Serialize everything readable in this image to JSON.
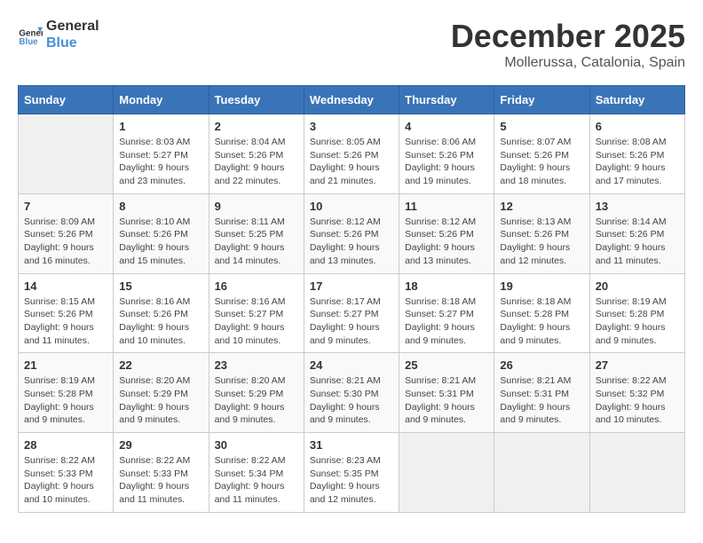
{
  "header": {
    "logo_line1": "General",
    "logo_line2": "Blue",
    "title": "December 2025",
    "subtitle": "Mollerussa, Catalonia, Spain"
  },
  "weekdays": [
    "Sunday",
    "Monday",
    "Tuesday",
    "Wednesday",
    "Thursday",
    "Friday",
    "Saturday"
  ],
  "weeks": [
    [
      {
        "day": "",
        "info": ""
      },
      {
        "day": "1",
        "info": "Sunrise: 8:03 AM\nSunset: 5:27 PM\nDaylight: 9 hours\nand 23 minutes."
      },
      {
        "day": "2",
        "info": "Sunrise: 8:04 AM\nSunset: 5:26 PM\nDaylight: 9 hours\nand 22 minutes."
      },
      {
        "day": "3",
        "info": "Sunrise: 8:05 AM\nSunset: 5:26 PM\nDaylight: 9 hours\nand 21 minutes."
      },
      {
        "day": "4",
        "info": "Sunrise: 8:06 AM\nSunset: 5:26 PM\nDaylight: 9 hours\nand 19 minutes."
      },
      {
        "day": "5",
        "info": "Sunrise: 8:07 AM\nSunset: 5:26 PM\nDaylight: 9 hours\nand 18 minutes."
      },
      {
        "day": "6",
        "info": "Sunrise: 8:08 AM\nSunset: 5:26 PM\nDaylight: 9 hours\nand 17 minutes."
      }
    ],
    [
      {
        "day": "7",
        "info": "Sunrise: 8:09 AM\nSunset: 5:26 PM\nDaylight: 9 hours\nand 16 minutes."
      },
      {
        "day": "8",
        "info": "Sunrise: 8:10 AM\nSunset: 5:26 PM\nDaylight: 9 hours\nand 15 minutes."
      },
      {
        "day": "9",
        "info": "Sunrise: 8:11 AM\nSunset: 5:25 PM\nDaylight: 9 hours\nand 14 minutes."
      },
      {
        "day": "10",
        "info": "Sunrise: 8:12 AM\nSunset: 5:26 PM\nDaylight: 9 hours\nand 13 minutes."
      },
      {
        "day": "11",
        "info": "Sunrise: 8:12 AM\nSunset: 5:26 PM\nDaylight: 9 hours\nand 13 minutes."
      },
      {
        "day": "12",
        "info": "Sunrise: 8:13 AM\nSunset: 5:26 PM\nDaylight: 9 hours\nand 12 minutes."
      },
      {
        "day": "13",
        "info": "Sunrise: 8:14 AM\nSunset: 5:26 PM\nDaylight: 9 hours\nand 11 minutes."
      }
    ],
    [
      {
        "day": "14",
        "info": "Sunrise: 8:15 AM\nSunset: 5:26 PM\nDaylight: 9 hours\nand 11 minutes."
      },
      {
        "day": "15",
        "info": "Sunrise: 8:16 AM\nSunset: 5:26 PM\nDaylight: 9 hours\nand 10 minutes."
      },
      {
        "day": "16",
        "info": "Sunrise: 8:16 AM\nSunset: 5:27 PM\nDaylight: 9 hours\nand 10 minutes."
      },
      {
        "day": "17",
        "info": "Sunrise: 8:17 AM\nSunset: 5:27 PM\nDaylight: 9 hours\nand 9 minutes."
      },
      {
        "day": "18",
        "info": "Sunrise: 8:18 AM\nSunset: 5:27 PM\nDaylight: 9 hours\nand 9 minutes."
      },
      {
        "day": "19",
        "info": "Sunrise: 8:18 AM\nSunset: 5:28 PM\nDaylight: 9 hours\nand 9 minutes."
      },
      {
        "day": "20",
        "info": "Sunrise: 8:19 AM\nSunset: 5:28 PM\nDaylight: 9 hours\nand 9 minutes."
      }
    ],
    [
      {
        "day": "21",
        "info": "Sunrise: 8:19 AM\nSunset: 5:28 PM\nDaylight: 9 hours\nand 9 minutes."
      },
      {
        "day": "22",
        "info": "Sunrise: 8:20 AM\nSunset: 5:29 PM\nDaylight: 9 hours\nand 9 minutes."
      },
      {
        "day": "23",
        "info": "Sunrise: 8:20 AM\nSunset: 5:29 PM\nDaylight: 9 hours\nand 9 minutes."
      },
      {
        "day": "24",
        "info": "Sunrise: 8:21 AM\nSunset: 5:30 PM\nDaylight: 9 hours\nand 9 minutes."
      },
      {
        "day": "25",
        "info": "Sunrise: 8:21 AM\nSunset: 5:31 PM\nDaylight: 9 hours\nand 9 minutes."
      },
      {
        "day": "26",
        "info": "Sunrise: 8:21 AM\nSunset: 5:31 PM\nDaylight: 9 hours\nand 9 minutes."
      },
      {
        "day": "27",
        "info": "Sunrise: 8:22 AM\nSunset: 5:32 PM\nDaylight: 9 hours\nand 10 minutes."
      }
    ],
    [
      {
        "day": "28",
        "info": "Sunrise: 8:22 AM\nSunset: 5:33 PM\nDaylight: 9 hours\nand 10 minutes."
      },
      {
        "day": "29",
        "info": "Sunrise: 8:22 AM\nSunset: 5:33 PM\nDaylight: 9 hours\nand 11 minutes."
      },
      {
        "day": "30",
        "info": "Sunrise: 8:22 AM\nSunset: 5:34 PM\nDaylight: 9 hours\nand 11 minutes."
      },
      {
        "day": "31",
        "info": "Sunrise: 8:23 AM\nSunset: 5:35 PM\nDaylight: 9 hours\nand 12 minutes."
      },
      {
        "day": "",
        "info": ""
      },
      {
        "day": "",
        "info": ""
      },
      {
        "day": "",
        "info": ""
      }
    ]
  ]
}
